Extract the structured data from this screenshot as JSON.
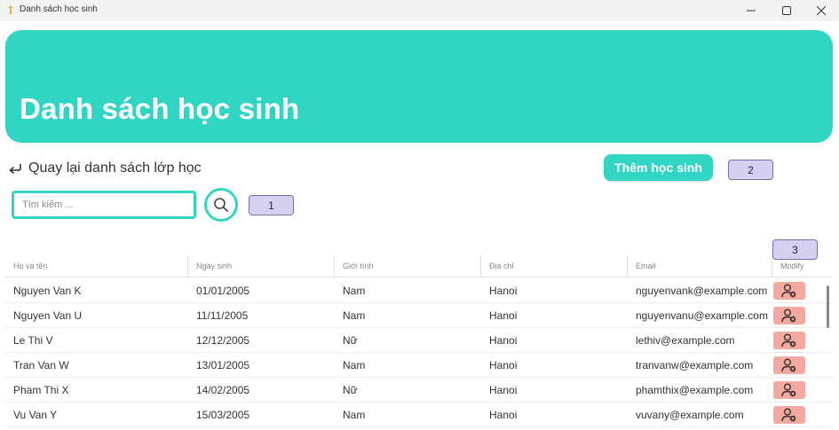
{
  "window": {
    "title": "Danh sách học sinh",
    "controls": [
      "minimize-icon",
      "maximize-icon",
      "close-icon"
    ]
  },
  "banner": {
    "heading": "Danh sách học sinh",
    "color": "#30d5c4"
  },
  "nav": {
    "back_label": "Quay lại danh sách lớp học"
  },
  "actions": {
    "add_label": "Thêm học sinh"
  },
  "search": {
    "placeholder": "Tìm kiếm ..."
  },
  "annotations": {
    "one": "1",
    "two": "2",
    "three": "3"
  },
  "table": {
    "columns": [
      "Họ và tên",
      "Ngày sinh",
      "Giới tính",
      "Địa chỉ",
      "Email",
      "Modify"
    ],
    "rows": [
      [
        "Nguyen Van K",
        "01/01/2005",
        "Nam",
        "Hanoi",
        "nguyenvank@example.com"
      ],
      [
        "Nguyen Van U",
        "11/11/2005",
        "Nam",
        "Hanoi",
        "nguyenvanu@example.com"
      ],
      [
        "Le Thi V",
        "12/12/2005",
        "Nữ",
        "Hanoi",
        "lethiv@example.com"
      ],
      [
        "Tran Van W",
        "13/01/2005",
        "Nam",
        "Hanoi",
        "tranvanw@example.com"
      ],
      [
        "Pham Thi X",
        "14/02/2005",
        "Nữ",
        "Hanoi",
        "phamthix@example.com"
      ],
      [
        "Vu Van Y",
        "15/03/2005",
        "Nam",
        "Hanoi",
        "vuvany@example.com"
      ]
    ],
    "modify_icon": "user-edit-icon",
    "modify_color": "#f4a9a0"
  },
  "colors": {
    "accent": "#30d5c4",
    "badge_fill": "#d8d0f0",
    "badge_border": "#7a6aa8"
  }
}
